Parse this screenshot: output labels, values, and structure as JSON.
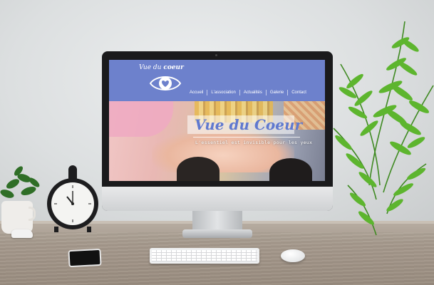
{
  "site": {
    "logo": {
      "text_plain": "Vue du",
      "text_accent": "coeur"
    },
    "nav": [
      "Accueil",
      "L'association",
      "Actualités",
      "Galerie",
      "Contact"
    ],
    "hero": {
      "title": "Vue du Coeur",
      "subtitle": "L'essentiel est invisible pour les yeux"
    }
  },
  "colors": {
    "header_blue": "#6d81cc",
    "title_blue": "#5f79cf"
  },
  "icons": [
    "eye-heart-logo-icon"
  ]
}
